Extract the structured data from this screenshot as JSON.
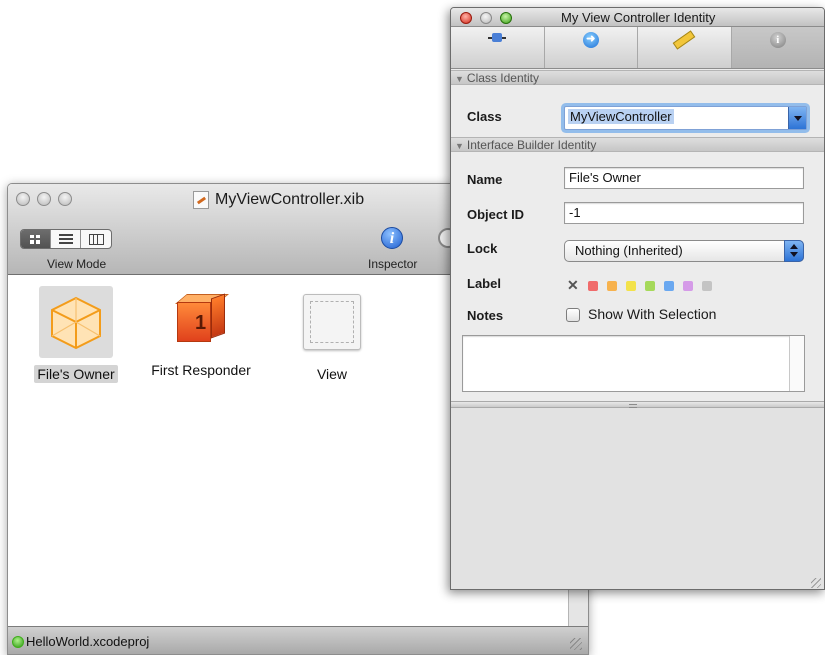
{
  "xib_window": {
    "title": "MyViewController.xib",
    "toolbar": {
      "view_mode_label": "View Mode",
      "inspector_label": "Inspector",
      "inspector_icon": "info-icon"
    },
    "objects": [
      {
        "label": "File's Owner",
        "icon": "cube-icon",
        "selected": true
      },
      {
        "label": "First Responder",
        "icon": "first-responder-icon",
        "selected": false
      },
      {
        "label": "View",
        "icon": "view-icon",
        "selected": false
      }
    ],
    "status": {
      "text": "HelloWorld.xcodeproj",
      "indicator_color": "#3fae1b"
    }
  },
  "inspector": {
    "title": "My View Controller Identity",
    "tabs": [
      {
        "icon": "attributes-icon"
      },
      {
        "icon": "connections-icon"
      },
      {
        "icon": "size-ruler-icon"
      },
      {
        "icon": "identity-info-icon",
        "active": true
      }
    ],
    "class_identity": {
      "header": "Class Identity",
      "class_label": "Class",
      "class_value": "MyViewController"
    },
    "ib_identity": {
      "header": "Interface Builder Identity",
      "name_label": "Name",
      "name_value": "File's Owner",
      "object_id_label": "Object ID",
      "object_id_value": "-1",
      "lock_label": "Lock",
      "lock_value": "Nothing (Inherited)",
      "label_label": "Label",
      "label_colors": [
        "#f06b6b",
        "#f7b24d",
        "#f3e24a",
        "#a6d95a",
        "#6aa8f0",
        "#d59be8",
        "#c4c4c4"
      ],
      "notes_label": "Notes",
      "show_with_selection": "Show With Selection"
    }
  }
}
